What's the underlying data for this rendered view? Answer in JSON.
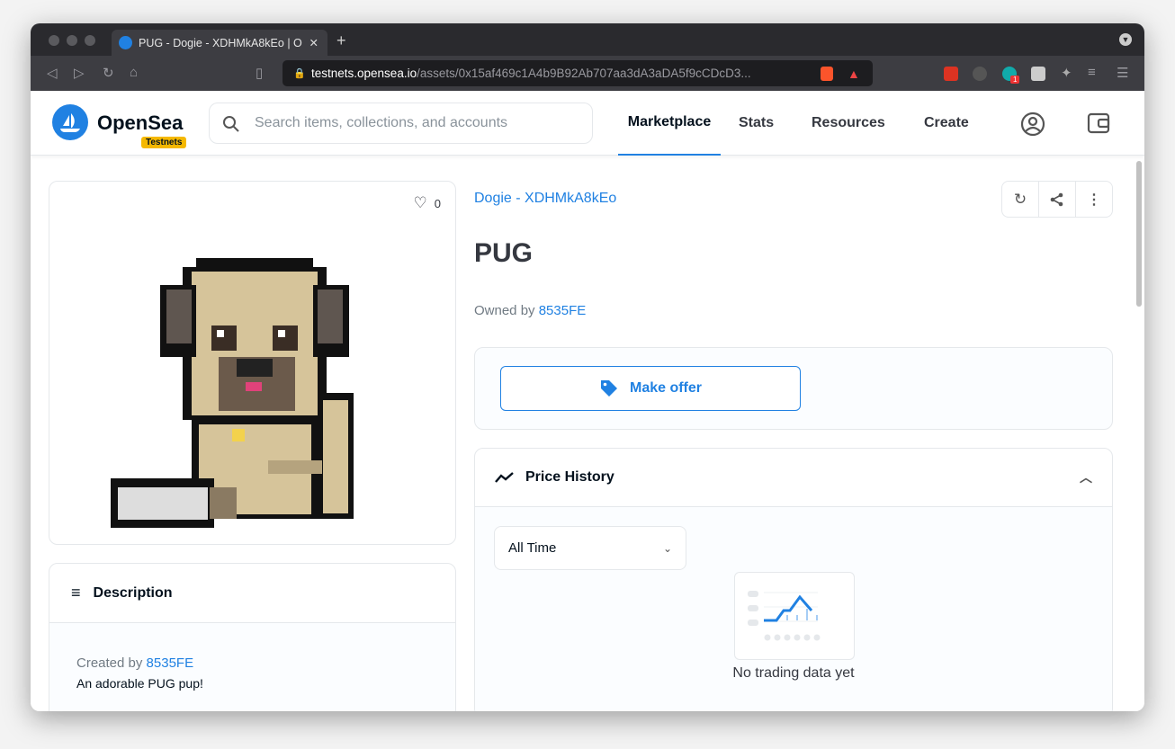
{
  "browser": {
    "tab_title": "PUG - Dogie - XDHMkA8kEo | O",
    "url_host": "testnets.opensea.io",
    "url_path": "/assets/0x15af469c1A4b9B92Ab707aa3dA3aDA5f9cCDcD3...",
    "ext_badge": "1"
  },
  "header": {
    "brand": "OpenSea",
    "badge": "Testnets",
    "search_placeholder": "Search items, collections, and accounts",
    "nav": [
      "Marketplace",
      "Stats",
      "Resources",
      "Create"
    ]
  },
  "asset": {
    "likes": "0",
    "collection": "Dogie - XDHMkA8kEo",
    "title": "PUG",
    "owned_by_label": "Owned by",
    "owner": "8535FE",
    "make_offer": "Make offer"
  },
  "description": {
    "title": "Description",
    "created_by_label": "Created by",
    "creator": "8535FE",
    "text": "An adorable PUG pup!"
  },
  "price_history": {
    "title": "Price History",
    "range": "All Time",
    "empty": "No trading data yet"
  },
  "colors": {
    "accent": "#2081e2",
    "badge": "#f5b800"
  }
}
